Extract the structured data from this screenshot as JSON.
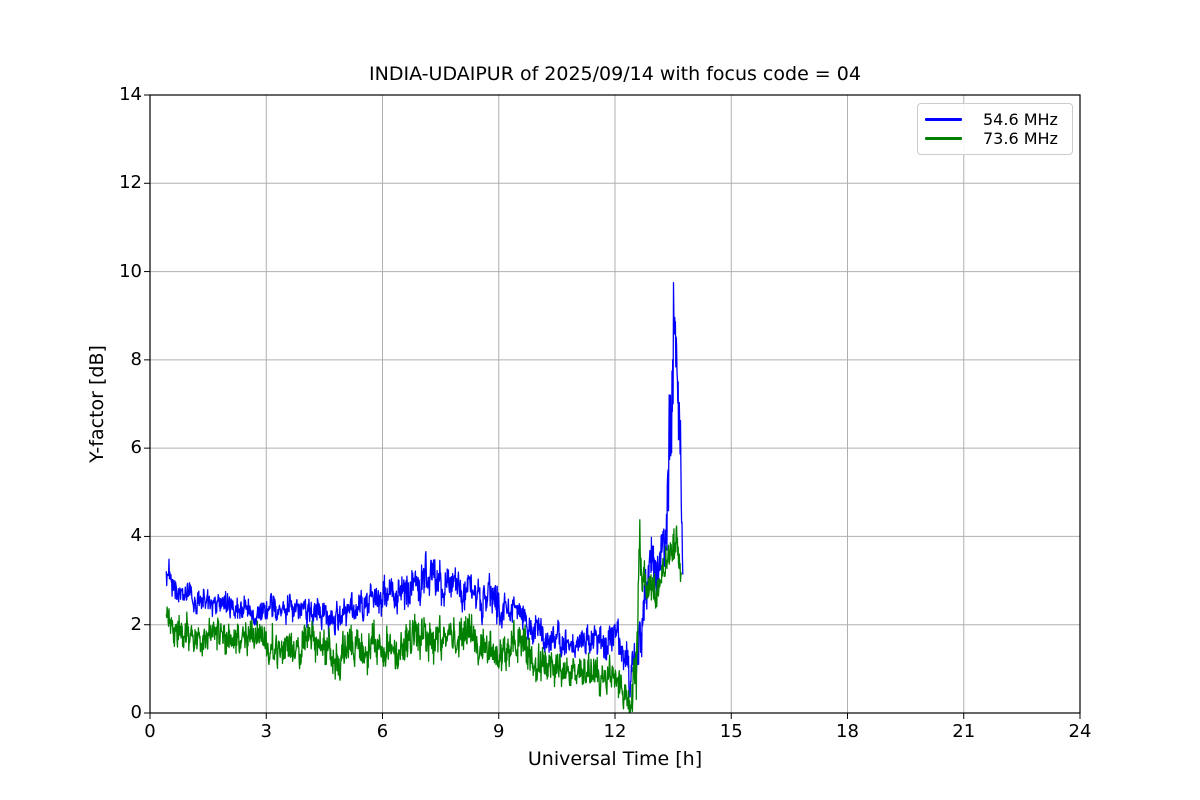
{
  "chart_data": {
    "type": "line",
    "title": "INDIA-UDAIPUR of 2025/09/14 with focus code = 04",
    "xlabel": "Universal Time [h]",
    "ylabel": "Y-factor [dB]",
    "xlim": [
      0,
      24
    ],
    "ylim": [
      0,
      14
    ],
    "xticks": [
      0,
      3,
      6,
      9,
      12,
      15,
      18,
      21,
      24
    ],
    "yticks": [
      0,
      2,
      4,
      6,
      8,
      10,
      12,
      14
    ],
    "grid": true,
    "grid_color": "#b0b0b0",
    "spine_color": "#000000",
    "background_color": "#ffffff",
    "legend": {
      "position": "upper right",
      "border_color": "#cccccc",
      "entries": [
        {
          "label": "54.6 MHz",
          "color": "#0000ff"
        },
        {
          "label": "73.6 MHz",
          "color": "#008000"
        }
      ]
    },
    "series": [
      {
        "name": "54.6 MHz",
        "color": "#0000ff",
        "x_range": [
          0.42,
          13.75
        ],
        "observed_max": 10.0,
        "observed_min": 0.05,
        "peak": {
          "t": 13.55,
          "value": 10.0
        },
        "envelope": [
          [
            0.42,
            3.1,
            0.3
          ],
          [
            0.55,
            2.95,
            0.32
          ],
          [
            0.8,
            2.72,
            0.3
          ],
          [
            1.2,
            2.58,
            0.3
          ],
          [
            1.7,
            2.48,
            0.28
          ],
          [
            2.2,
            2.42,
            0.28
          ],
          [
            2.7,
            2.32,
            0.28
          ],
          [
            3.2,
            2.28,
            0.3
          ],
          [
            3.7,
            2.35,
            0.32
          ],
          [
            4.1,
            2.48,
            0.38
          ],
          [
            4.5,
            2.25,
            0.32
          ],
          [
            4.8,
            1.95,
            0.42
          ],
          [
            5.1,
            2.28,
            0.32
          ],
          [
            5.6,
            2.5,
            0.35
          ],
          [
            6.1,
            2.62,
            0.38
          ],
          [
            6.6,
            2.82,
            0.42
          ],
          [
            7.0,
            3.05,
            0.5
          ],
          [
            7.4,
            2.95,
            0.42
          ],
          [
            7.9,
            2.85,
            0.38
          ],
          [
            8.4,
            2.65,
            0.38
          ],
          [
            8.95,
            2.5,
            0.5
          ],
          [
            9.3,
            2.28,
            0.35
          ],
          [
            9.7,
            2.1,
            0.32
          ],
          [
            10.1,
            1.85,
            0.32
          ],
          [
            10.6,
            1.6,
            0.32
          ],
          [
            11.0,
            1.48,
            0.3
          ],
          [
            11.4,
            1.58,
            0.32
          ],
          [
            11.87,
            1.8,
            0.45
          ],
          [
            12.15,
            1.55,
            0.42
          ],
          [
            12.35,
            1.1,
            0.45
          ],
          [
            12.55,
            0.75,
            0.55
          ],
          [
            12.65,
            1.6,
            0.9
          ],
          [
            12.78,
            2.9,
            0.7
          ],
          [
            13.0,
            3.2,
            0.65
          ],
          [
            13.2,
            3.4,
            0.6
          ],
          [
            13.33,
            4.0,
            0.9
          ],
          [
            13.44,
            6.4,
            2.0
          ],
          [
            13.52,
            8.3,
            1.6
          ],
          [
            13.6,
            8.3,
            1.4
          ],
          [
            13.66,
            6.6,
            1.5
          ],
          [
            13.71,
            4.3,
            1.0
          ],
          [
            13.75,
            3.0,
            0.25
          ]
        ]
      },
      {
        "name": "73.6 MHz",
        "color": "#008000",
        "x_range": [
          0.42,
          13.72
        ],
        "observed_max": 4.55,
        "observed_min": 0.02,
        "peak": {
          "t": 13.5,
          "value": 4.5
        },
        "envelope": [
          [
            0.42,
            2.2,
            0.32
          ],
          [
            0.6,
            1.92,
            0.4
          ],
          [
            1.0,
            1.78,
            0.42
          ],
          [
            1.5,
            1.72,
            0.42
          ],
          [
            2.0,
            1.78,
            0.4
          ],
          [
            2.45,
            1.82,
            0.45
          ],
          [
            2.8,
            1.58,
            0.4
          ],
          [
            3.3,
            1.52,
            0.4
          ],
          [
            3.8,
            1.58,
            0.4
          ],
          [
            4.3,
            1.52,
            0.4
          ],
          [
            4.8,
            1.28,
            0.45
          ],
          [
            5.2,
            1.48,
            0.4
          ],
          [
            5.7,
            1.42,
            0.48
          ],
          [
            6.2,
            1.52,
            0.42
          ],
          [
            6.8,
            1.68,
            0.5
          ],
          [
            7.3,
            1.58,
            0.45
          ],
          [
            7.8,
            1.62,
            0.45
          ],
          [
            8.1,
            1.72,
            0.48
          ],
          [
            8.6,
            1.48,
            0.4
          ],
          [
            9.1,
            1.38,
            0.4
          ],
          [
            9.5,
            1.48,
            0.5
          ],
          [
            9.9,
            1.18,
            0.4
          ],
          [
            10.4,
            0.98,
            0.4
          ],
          [
            10.9,
            0.88,
            0.35
          ],
          [
            11.4,
            0.78,
            0.38
          ],
          [
            11.9,
            0.88,
            0.38
          ],
          [
            12.2,
            0.55,
            0.35
          ],
          [
            12.33,
            0.3,
            0.28
          ],
          [
            12.45,
            0.5,
            0.45
          ],
          [
            12.56,
            1.5,
            1.0
          ],
          [
            12.63,
            3.55,
            0.65
          ],
          [
            12.72,
            2.95,
            0.5
          ],
          [
            12.9,
            2.85,
            0.48
          ],
          [
            13.1,
            2.95,
            0.48
          ],
          [
            13.3,
            3.2,
            0.52
          ],
          [
            13.45,
            3.9,
            0.55
          ],
          [
            13.55,
            3.8,
            0.55
          ],
          [
            13.65,
            3.45,
            0.4
          ],
          [
            13.72,
            3.25,
            0.25
          ]
        ]
      }
    ],
    "noise": {
      "seed": 20250914,
      "dt": 0.01,
      "ar": 0.8,
      "ar_in": 1.0,
      "ar_gain": 0.8,
      "white_gain": 1.4
    }
  }
}
